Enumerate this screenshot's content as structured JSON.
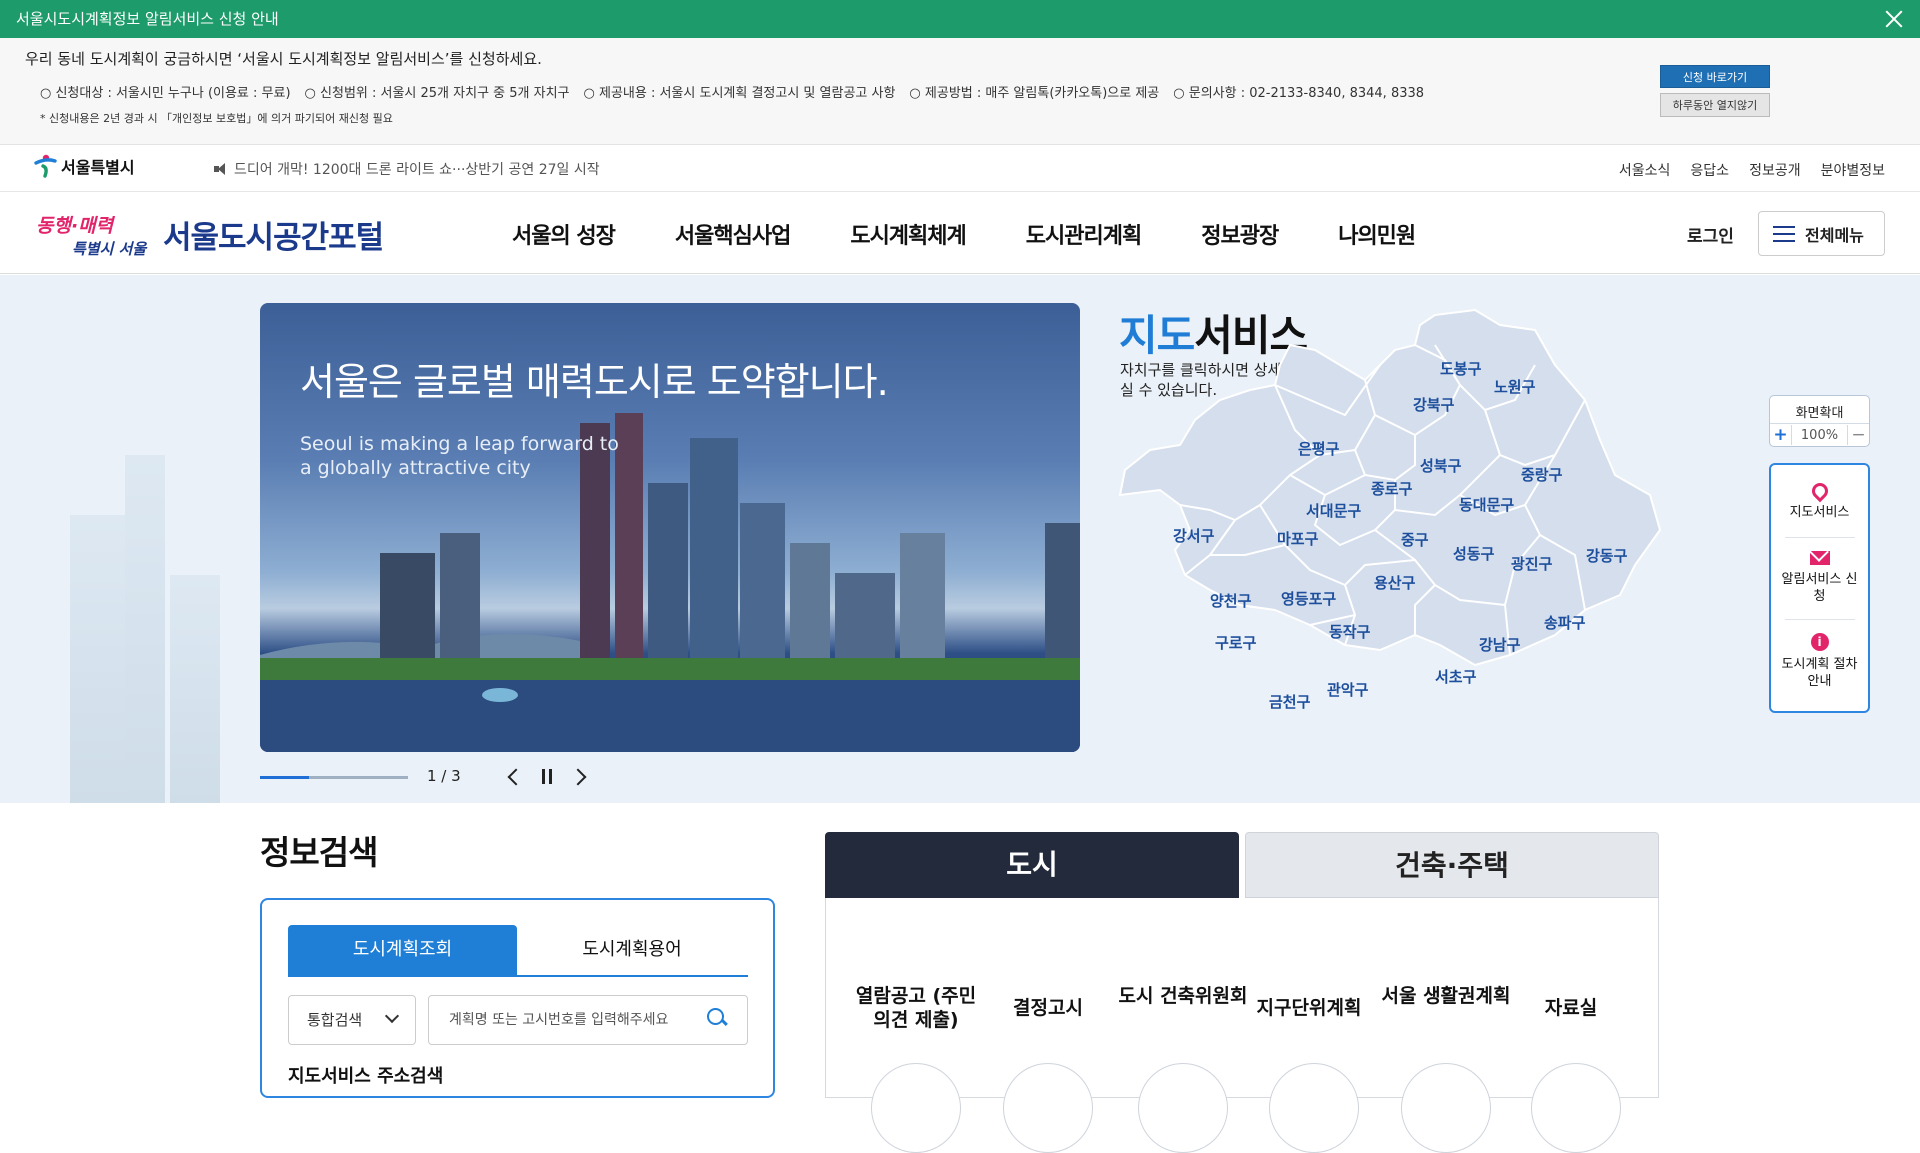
{
  "notice": {
    "title": "서울시도시계획정보 알림서비스 신청 안내",
    "intro": "우리 동네 도시계획이 궁금하시면 ‘서울시 도시계획정보 알림서비스’를 신청하세요.",
    "items": [
      "○ 신청대상 : 서울시민 누구나 (이용료 : 무료)",
      "○ 신청범위 : 서울시 25개 자치구 중 5개 자치구",
      "○ 제공내용 : 서울시 도시계획 결정고시 및 열람공고 사항",
      "○ 제공방법 : 매주 알림톡(카카오톡)으로 제공",
      "○ 문의사항 :  02-2133-8340, 8344, 8338"
    ],
    "footnote": "* 신청내용은 2년 경과 시 「개인정보 보호법」에 의거 파기되어 재신청 필요",
    "apply_label": "신청 바로가기",
    "hide_label": "하루동안 열지않기"
  },
  "util": {
    "seoul_label": "서울특별시",
    "ticker": "드디어 개막! 1200대 드론 라이트 쇼···상반기 공연 27일 시작",
    "links": [
      "서울소식",
      "응답소",
      "정보공개",
      "분야별정보"
    ]
  },
  "header": {
    "slogan": "동행·매력 특별시 서울",
    "title": "서울도시공간포털",
    "nav": [
      "서울의 성장",
      "서울핵심사업",
      "도시계획체계",
      "도시관리계획",
      "정보광장",
      "나의민원"
    ],
    "login": "로그인",
    "allmenu": "전체메뉴"
  },
  "hero": {
    "title": "서울은 글로벌 매력도시로 도약합니다.",
    "subtitle": "Seoul is making a leap forward to a globally attractive city",
    "counter": "1 / 3",
    "progress": 0.33
  },
  "map": {
    "title_highlight": "지도",
    "title_rest": "서비스",
    "desc": "자치구를 클릭하시면 상세정보를 보실 수 있습니다.",
    "districts": [
      "도봉구",
      "노원구",
      "강북구",
      "은평구",
      "성북구",
      "중랑구",
      "종로구",
      "서대문구",
      "동대문구",
      "마포구",
      "중구",
      "강서구",
      "성동구",
      "광진구",
      "강동구",
      "용산구",
      "양천구",
      "영등포구",
      "동작구",
      "송파구",
      "구로구",
      "강남구",
      "서초구",
      "관악구",
      "금천구"
    ]
  },
  "side": {
    "zoom_label": "화면확대",
    "zoom_value": "100%",
    "plus": "+",
    "minus": "−",
    "quick": [
      "지도서비스",
      "알림서비스 신청",
      "도시계획 절차안내"
    ]
  },
  "search": {
    "title": "정보검색",
    "tab_active": "도시계획조회",
    "tab_other": "도시계획용어",
    "select_value": "통합검색",
    "placeholder": "계획명 또는 고시번호를 입력해주세요",
    "sub_label": "지도서비스 주소검색"
  },
  "category": {
    "tab_active": "도시",
    "tab_other": "건축·주택",
    "items": [
      "열람공고 (주민의견 제출)",
      "결정고시",
      "도시 건축위원회",
      "지구단위계획",
      "서울 생활권계획",
      "자료실"
    ]
  },
  "colors": {
    "banner": "#1e9b6b",
    "accent": "#1f7fd6",
    "navy": "#1b3a8c",
    "pink": "#e2246a"
  }
}
